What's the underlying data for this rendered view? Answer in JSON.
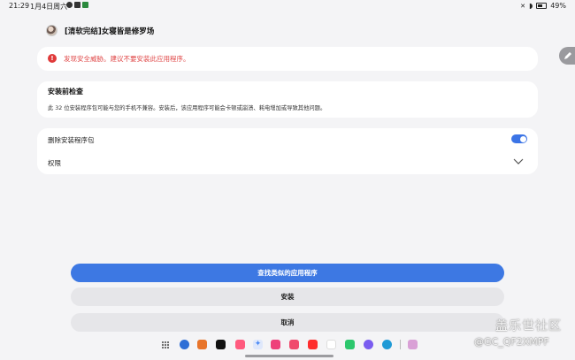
{
  "status_bar": {
    "time": "21:29",
    "date": "1月4日周六",
    "battery": "49%"
  },
  "header": {
    "title": "[清软完结]女寝皆是修罗场"
  },
  "warning": {
    "icon_glyph": "!",
    "text": "发现安全威胁。建议不要安装此应用程序。",
    "color": "#e04848"
  },
  "precheck": {
    "title": "安装前检查",
    "description": "此 32 位安装程序包可能与您的手机不兼容。安装后，该应用程序可能会卡顿或崩溃、耗电增加或导致其他问题。"
  },
  "options": {
    "delete_package_label": "删除安装程序包",
    "delete_package_enabled": true,
    "permissions_label": "权限"
  },
  "buttons": {
    "find_similar": "查找类似的应用程序",
    "install": "安装",
    "cancel": "取消"
  },
  "colors": {
    "accent": "#3d78e3",
    "background": "#f4f4f6",
    "card": "#ffffff"
  },
  "taskbar": {
    "apps": [
      {
        "name": "app-drawer-icon"
      },
      {
        "name": "browser-icon",
        "color": "#2f6fd6"
      },
      {
        "name": "game-icon",
        "color": "#e8742a"
      },
      {
        "name": "tiktok-icon",
        "color": "#111111"
      },
      {
        "name": "bilibili-icon",
        "color": "#ff5a7e"
      },
      {
        "name": "sparkle-icon",
        "color": "#4d8bf5"
      },
      {
        "name": "flower-icon",
        "color": "#ee3f7a"
      },
      {
        "name": "video-icon",
        "color": "#f04a6d"
      },
      {
        "name": "red-app-icon",
        "color": "#ff2d2d"
      },
      {
        "name": "qq-icon",
        "color": "#222222"
      },
      {
        "name": "wechat-icon",
        "color": "#2dc76d"
      },
      {
        "name": "purple-app-icon",
        "color": "#7a5cf0"
      },
      {
        "name": "edge-icon",
        "color": "#1f9ad6"
      },
      {
        "name": "recent-app-icon",
        "color": "#d9a0d6"
      }
    ]
  },
  "watermark": {
    "title": "盖乐世社区",
    "user": "@GC_QF2XMPF"
  }
}
